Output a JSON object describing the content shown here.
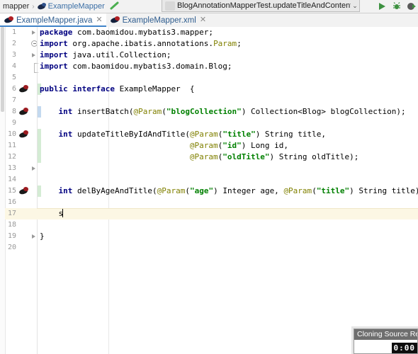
{
  "breadcrumb": {
    "package": "mapper",
    "separator": "›",
    "class": "ExampleMapper",
    "class_icon": "mybatis-mapper-icon",
    "check_icon": "green-check-icon"
  },
  "run_config": {
    "label": "BlogAnnotationMapperTest.updateTitleAndContentByIdAndTitle",
    "caret": "⌄",
    "config_icon": "run-configuration-icon"
  },
  "toolbar": {
    "icons": [
      {
        "name": "run-icon",
        "label": "Run",
        "color": "#3d9140"
      },
      {
        "name": "debug-icon",
        "label": "Debug",
        "color": "#3d9140"
      },
      {
        "name": "run-with-coverage-icon",
        "label": "Run with Coverage",
        "color": "#3d9140"
      }
    ]
  },
  "tabs": [
    {
      "label": "ExampleMapper.java",
      "icon": "java-mapper-icon",
      "close": "✕",
      "active": true
    },
    {
      "label": "ExampleMapper.xml",
      "icon": "xml-mapper-icon",
      "close": "✕",
      "active": false
    }
  ],
  "editor": {
    "current_line": 17,
    "lines": [
      {
        "n": "1",
        "marker": "",
        "fold": "tri",
        "change": "",
        "tokens": [
          {
            "t": "kw",
            "v": "package"
          },
          {
            "t": "pln",
            "v": " com.baomidou.mybatis3.mapper;"
          }
        ]
      },
      {
        "n": "2",
        "marker": "",
        "fold": "minus",
        "change": "",
        "tokens": [
          {
            "t": "kw",
            "v": "import"
          },
          {
            "t": "pln",
            "v": " org.apache.ibatis.annotations."
          },
          {
            "t": "ann",
            "v": "Param"
          },
          {
            "t": "pln",
            "v": ";"
          }
        ]
      },
      {
        "n": "3",
        "marker": "",
        "fold": "tri2",
        "change": "",
        "tokens": [
          {
            "t": "kw",
            "v": "import"
          },
          {
            "t": "pln",
            "v": " java.util.Collection;"
          }
        ]
      },
      {
        "n": "4",
        "marker": "",
        "fold": "bracket",
        "change": "",
        "tokens": [
          {
            "t": "kw",
            "v": "import"
          },
          {
            "t": "pln",
            "v": " com.baomidou.mybatis3.domain.Blog;"
          }
        ]
      },
      {
        "n": "5",
        "marker": "",
        "fold": "",
        "change": "",
        "tokens": []
      },
      {
        "n": "6",
        "marker": "bird",
        "fold": "",
        "change": "green",
        "tokens": [
          {
            "t": "kw",
            "v": "public interface"
          },
          {
            "t": "pln",
            "v": " ExampleMapper  {"
          }
        ]
      },
      {
        "n": "7",
        "marker": "",
        "fold": "",
        "change": "",
        "tokens": []
      },
      {
        "n": "8",
        "marker": "bird",
        "fold": "",
        "change": "blue",
        "tokens": [
          {
            "t": "pln",
            "v": "    "
          },
          {
            "t": "kw",
            "v": "int"
          },
          {
            "t": "pln",
            "v": " insertBatch("
          },
          {
            "t": "ann",
            "v": "@Param"
          },
          {
            "t": "pln",
            "v": "("
          },
          {
            "t": "str",
            "v": "\"blogCollection\""
          },
          {
            "t": "pln",
            "v": ") Collection<Blog> blogCollection);"
          }
        ]
      },
      {
        "n": "9",
        "marker": "",
        "fold": "",
        "change": "",
        "tokens": []
      },
      {
        "n": "10",
        "marker": "bird",
        "fold": "",
        "change": "green",
        "tokens": [
          {
            "t": "pln",
            "v": "    "
          },
          {
            "t": "kw",
            "v": "int"
          },
          {
            "t": "pln",
            "v": " updateTitleByIdAndTitle("
          },
          {
            "t": "ann",
            "v": "@Param"
          },
          {
            "t": "pln",
            "v": "("
          },
          {
            "t": "str",
            "v": "\"title\""
          },
          {
            "t": "pln",
            "v": ") String title,"
          }
        ]
      },
      {
        "n": "11",
        "marker": "",
        "fold": "",
        "change": "green",
        "tokens": [
          {
            "t": "pln",
            "v": "                                "
          },
          {
            "t": "ann",
            "v": "@Param"
          },
          {
            "t": "pln",
            "v": "("
          },
          {
            "t": "str",
            "v": "\"id\""
          },
          {
            "t": "pln",
            "v": ") Long id,"
          }
        ]
      },
      {
        "n": "12",
        "marker": "",
        "fold": "",
        "change": "green",
        "tokens": [
          {
            "t": "pln",
            "v": "                                "
          },
          {
            "t": "ann",
            "v": "@Param"
          },
          {
            "t": "pln",
            "v": "("
          },
          {
            "t": "str",
            "v": "\"oldTitle\""
          },
          {
            "t": "pln",
            "v": ") String oldTitle);"
          }
        ]
      },
      {
        "n": "13",
        "marker": "",
        "fold": "tri",
        "change": "",
        "tokens": []
      },
      {
        "n": "14",
        "marker": "",
        "fold": "",
        "change": "",
        "tokens": []
      },
      {
        "n": "15",
        "marker": "bird",
        "fold": "",
        "change": "green",
        "tokens": [
          {
            "t": "pln",
            "v": "    "
          },
          {
            "t": "kw",
            "v": "int"
          },
          {
            "t": "pln",
            "v": " delByAgeAndTitle("
          },
          {
            "t": "ann",
            "v": "@Param"
          },
          {
            "t": "pln",
            "v": "("
          },
          {
            "t": "str",
            "v": "\"age\""
          },
          {
            "t": "pln",
            "v": ") Integer age, "
          },
          {
            "t": "ann",
            "v": "@Param"
          },
          {
            "t": "pln",
            "v": "("
          },
          {
            "t": "str",
            "v": "\"title\""
          },
          {
            "t": "pln",
            "v": ") String title);"
          }
        ]
      },
      {
        "n": "16",
        "marker": "",
        "fold": "",
        "change": "",
        "tokens": []
      },
      {
        "n": "17",
        "marker": "",
        "fold": "",
        "change": "blue",
        "caret": true,
        "tokens": [
          {
            "t": "pln",
            "v": "    s"
          }
        ]
      },
      {
        "n": "18",
        "marker": "",
        "fold": "",
        "change": "",
        "tokens": []
      },
      {
        "n": "19",
        "marker": "",
        "fold": "tri",
        "change": "",
        "tokens": [
          {
            "t": "pln",
            "v": "}"
          }
        ]
      },
      {
        "n": "20",
        "marker": "",
        "fold": "",
        "change": "",
        "tokens": []
      }
    ]
  },
  "clone_dialog": {
    "title": "Cloning Source Re",
    "timer": "0:00"
  },
  "colors": {
    "keyword": "#000080",
    "string": "#008000",
    "annotation": "#808000",
    "tab_active_underline": "#4083c9",
    "current_line_bg": "#fcf7e4",
    "run_green": "#3d9140"
  }
}
